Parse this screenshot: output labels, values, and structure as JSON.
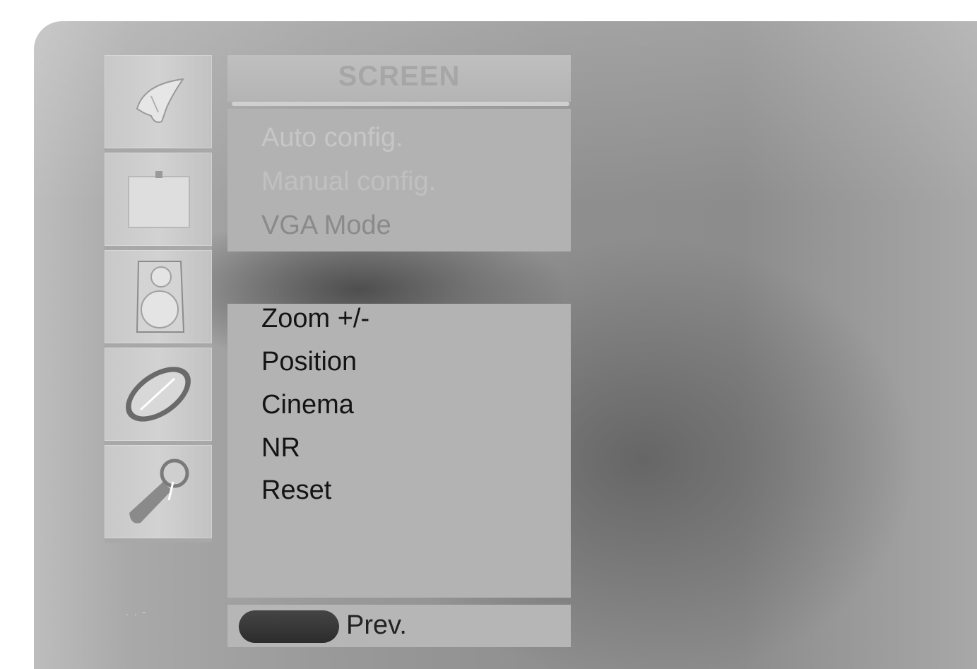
{
  "menu": {
    "title": "SCREEN",
    "top_items": [
      {
        "label": "Auto config."
      },
      {
        "label": "Manual config."
      },
      {
        "label": "VGA Mode"
      }
    ],
    "items": [
      {
        "label": "Zoom +/-"
      },
      {
        "label": "Position"
      },
      {
        "label": "Cinema"
      },
      {
        "label": "NR"
      },
      {
        "label": "Reset"
      }
    ]
  },
  "sidebar": {
    "icons": [
      {
        "name": "satellite-dish-icon"
      },
      {
        "name": "picture-icon"
      },
      {
        "name": "speaker-icon"
      },
      {
        "name": "clock-icon"
      },
      {
        "name": "key-icon"
      }
    ]
  },
  "footer": {
    "prev_label": "Prev."
  },
  "colors": {
    "panel": "#b5b5b5",
    "text": "#141414",
    "button": "#3a3a3a"
  }
}
